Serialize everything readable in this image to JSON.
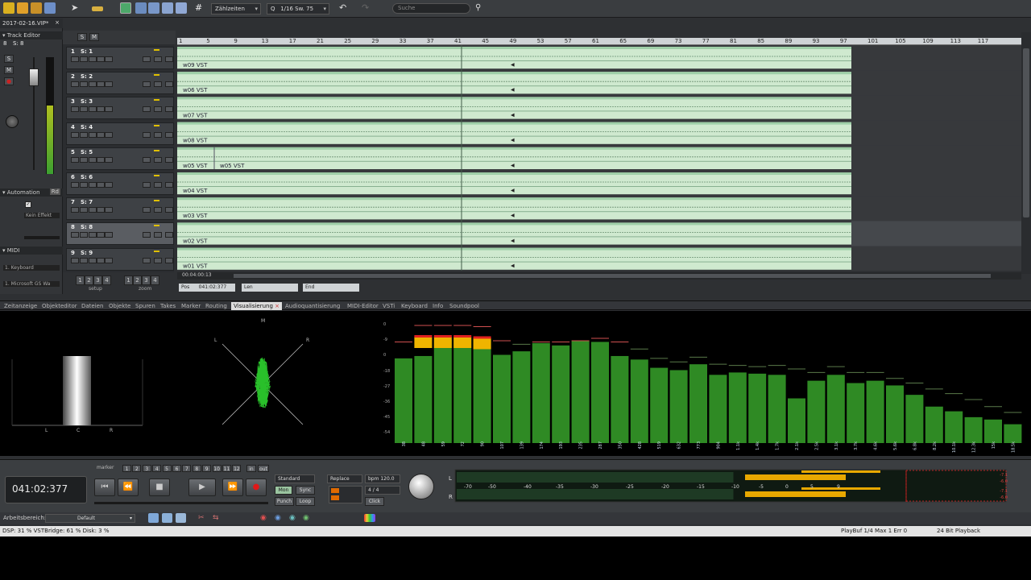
{
  "toolbar": {
    "snap_mode": "Zählzeiten",
    "quantize_label": "Q",
    "quantize_value": "1/16 Sw. 75",
    "search_placeholder": "Suche"
  },
  "inspector": {
    "project_tab": "2017-02-16.VIP*",
    "track_editor_label": "Track Editor",
    "track_sel_num": "8",
    "track_sel_name": "S: 8",
    "solo_btn": "S",
    "mute_btn": "M",
    "automation_label": "Automation",
    "automation_mode": "Rd",
    "effect_label": "Kein Effekt",
    "midi_label": "MIDI",
    "midi_in": "1. Keyboard",
    "midi_out": "1. Microsoft GS Wa",
    "setup_lbl": "setup",
    "zoom_lbl": "zoom"
  },
  "tracks": [
    {
      "num": "1",
      "name": "S: 1",
      "clip": "w09  VST"
    },
    {
      "num": "2",
      "name": "S: 2",
      "clip": "w06  VST"
    },
    {
      "num": "3",
      "name": "S: 3",
      "clip": "w07  VST"
    },
    {
      "num": "4",
      "name": "S: 4",
      "clip": "w08  VST"
    },
    {
      "num": "5",
      "name": "S: 5",
      "clip": "w05  VST",
      "clip2": "w05  VST"
    },
    {
      "num": "6",
      "name": "S: 6",
      "clip": "w04  VST"
    },
    {
      "num": "7",
      "name": "S: 7",
      "clip": "w03  VST"
    },
    {
      "num": "8",
      "name": "S: 8",
      "clip": "w02  VST"
    },
    {
      "num": "9",
      "name": "S: 9",
      "clip": "w01  VST"
    }
  ],
  "ruler": {
    "bars": [
      "1",
      "5",
      "9",
      "13",
      "17",
      "21",
      "25",
      "29",
      "33",
      "37",
      "41",
      "45",
      "49",
      "53",
      "57",
      "61",
      "65",
      "69",
      "73",
      "77",
      "81",
      "85",
      "89",
      "93",
      "97",
      "101",
      "105",
      "109",
      "113",
      "117"
    ]
  },
  "arrange": {
    "scroll_time": "00:04:00:13",
    "pos_label": "Pos",
    "pos_value": "041:02:377",
    "len_label": "Len",
    "end_label": "End"
  },
  "dock_tabs": [
    {
      "label": "Zeitanzeige"
    },
    {
      "label": "Objekteditor"
    },
    {
      "label": "Dateien"
    },
    {
      "label": "Objekte"
    },
    {
      "label": "Spuren"
    },
    {
      "label": "Takes"
    },
    {
      "label": "Marker"
    },
    {
      "label": "Routing"
    },
    {
      "label": "Visualisierung",
      "active": true
    },
    {
      "label": "Audioquantisierung"
    },
    {
      "label": "MIDI-Editor"
    },
    {
      "label": "VSTi"
    },
    {
      "label": "Keyboard"
    },
    {
      "label": "Info"
    },
    {
      "label": "Soundpool"
    }
  ],
  "visualisation": {
    "correlation_labels": [
      "L",
      "C",
      "R"
    ],
    "gonio_labels": {
      "top": "M",
      "left": "L",
      "right": "R"
    },
    "spectrum_scale": [
      "0",
      "-9",
      "0",
      "-18",
      "-27",
      "-36",
      "-45",
      "-54"
    ],
    "spectrum_freqs": [
      "38",
      "48",
      "59",
      "72",
      "90",
      "107",
      "139",
      "174",
      "193",
      "235",
      "287",
      "350",
      "428",
      "519",
      "632",
      "773",
      "904",
      "1.1k",
      "1.4k",
      "1.7k",
      "2.1k",
      "2.5k",
      "3.1k",
      "3.7k",
      "4.6k",
      "5.6k",
      "6.8k",
      "8.2k",
      "10.1k",
      "12.3k",
      "15k",
      "18.5k"
    ],
    "spectrum_levels": [
      0.72,
      0.74,
      0.88,
      0.89,
      0.89,
      0.75,
      0.78,
      0.85,
      0.83,
      0.87,
      0.86,
      0.74,
      0.71,
      0.64,
      0.62,
      0.67,
      0.58,
      0.6,
      0.59,
      0.58,
      0.38,
      0.53,
      0.58,
      0.51,
      0.53,
      0.49,
      0.41,
      0.31,
      0.27,
      0.22,
      0.2,
      0.16
    ],
    "spectrum_peaks": [
      0.86,
      1.0,
      1.0,
      1.0,
      0.99,
      0.87,
      0.84,
      0.86,
      0.86,
      0.87,
      0.89,
      0.86,
      0.8,
      0.72,
      0.69,
      0.73,
      0.67,
      0.66,
      0.65,
      0.66,
      0.63,
      0.6,
      0.65,
      0.6,
      0.6,
      0.55,
      0.51,
      0.46,
      0.42,
      0.37,
      0.31,
      0.26
    ]
  },
  "transport": {
    "time": "041:02:377",
    "mode_select": "Standard",
    "replace_select": "Replace",
    "bpm": "bpm 120.0",
    "signature": "4 / 4",
    "mon_btn": "Mon",
    "sync_btn": "Sync",
    "punch_btn": "Punch",
    "loop_btn": "Loop",
    "click_btn": "Click",
    "marker_label": "marker",
    "in_label": "in",
    "out_label": "out",
    "marker_nums": [
      "1",
      "2",
      "3",
      "4",
      "5",
      "6",
      "7",
      "8",
      "9",
      "10",
      "11",
      "12"
    ],
    "ch_l": "L",
    "ch_r": "R",
    "meter_scale": [
      "-70",
      "-50",
      "-40",
      "-35",
      "-30",
      "-25",
      "-20",
      "-15",
      "-10",
      "-5",
      "0",
      "5",
      "9"
    ],
    "peak_l": "-7.1",
    "peak_l2": "-6.0",
    "peak_r": "-7.1",
    "peak_r2": "-6.0",
    "level_l": 0.78,
    "level_r": 0.78
  },
  "workarea": {
    "label": "Arbeitsbereich:",
    "value": "Default"
  },
  "status": {
    "dsp": "DSP: 31 %  VSTBridge: 61 %   Disk:  3 %",
    "playbuf": "PlayBuf 1/4   Max 1   Err 0",
    "bit": "24 Bit Playback"
  },
  "colors": {
    "clip": "#cfe9cf",
    "clip_dark": "#9fcfa8",
    "spectrum_bar": "#2f8a24",
    "spectrum_peak": "#f0b400",
    "spectrum_clip": "#e02020",
    "gonio": "#29c02a",
    "meter": "#e8a800"
  }
}
